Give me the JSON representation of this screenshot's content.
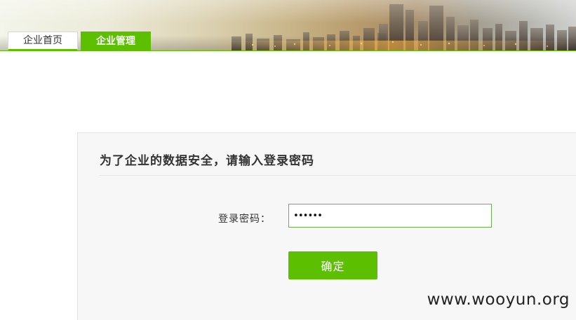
{
  "header": {
    "tabs": [
      {
        "label": "企业首页",
        "active": false
      },
      {
        "label": "企业管理",
        "active": true
      }
    ]
  },
  "login": {
    "title": "为了企业的数据安全，请输入登录密码",
    "password_label": "登录密码：",
    "password_value": "••••••",
    "submit_label": "确定"
  },
  "watermark": "www.wooyun.org",
  "colors": {
    "accent": "#5cbf00",
    "panel_bg": "#f7f7f7",
    "input_border": "#6ab04c"
  },
  "icons": [
    "city-skyline-banner"
  ]
}
